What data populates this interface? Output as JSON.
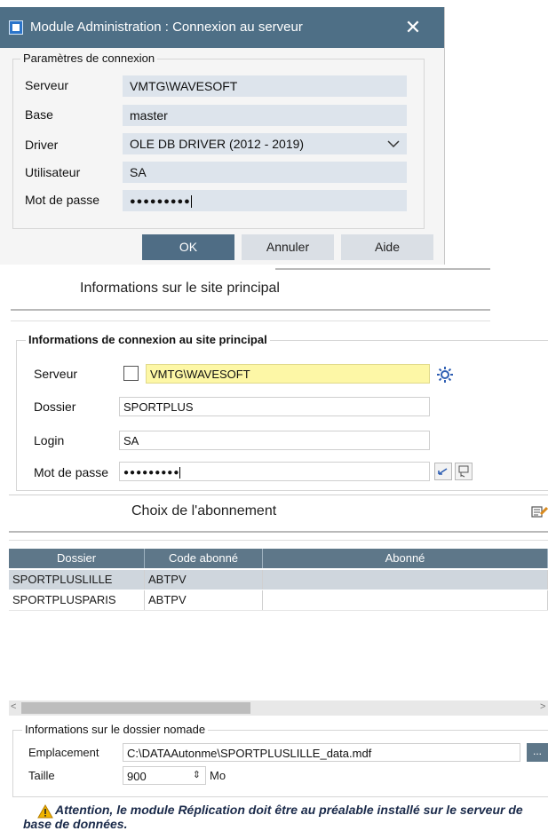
{
  "dialog": {
    "title": "Module Administration : Connexion au serveur",
    "close_glyph": "✕",
    "group_label": "Paramètres de connexion",
    "fields": {
      "server_label": "Serveur",
      "server_value": "VMTG\\WAVESOFT",
      "base_label": "Base",
      "base_value": "master",
      "driver_label": "Driver",
      "driver_value": "OLE DB DRIVER (2012 - 2019)",
      "user_label": "Utilisateur",
      "user_value": "SA",
      "password_label": "Mot de passe",
      "password_value": "●●●●●●●●●"
    },
    "buttons": {
      "ok": "OK",
      "cancel": "Annuler",
      "help": "Aide"
    }
  },
  "site": {
    "header": "Informations sur le site principal",
    "group_label": "Informations de connexion au site principal",
    "server_label": "Serveur",
    "server_value": "VMTG\\WAVESOFT",
    "folder_label": "Dossier",
    "folder_value": "SPORTPLUS",
    "login_label": "Login",
    "login_value": "SA",
    "password_label": "Mot de passe",
    "password_value": "●●●●●●●●●"
  },
  "subscription": {
    "header": "Choix de l'abonnement",
    "columns": [
      "Dossier",
      "Code abonné",
      "Abonné"
    ],
    "rows": [
      [
        "SPORTPLUSLILLE",
        "ABTPV",
        ""
      ],
      [
        "SPORTPLUSPARIS",
        "ABTPV",
        ""
      ]
    ]
  },
  "nomade": {
    "group_label": "Informations sur le dossier nomade",
    "location_label": "Emplacement",
    "location_value": "C:\\DATAAutonme\\SPORTPLUSLILLE_data.mdf",
    "browse_label": "...",
    "size_label": "Taille",
    "size_value": "900",
    "size_unit": "Mo"
  },
  "warning": {
    "text": "Attention, le module Réplication doit être au préalable installé sur le serveur  de base de données."
  },
  "colors": {
    "title_bar": "#4e6f86",
    "field_bg": "#dde4ec",
    "ok_button": "#4f6d85",
    "grid_header": "#5e7789",
    "selected_row": "#cfd6dd",
    "highlight_input": "#fdf7a6"
  }
}
